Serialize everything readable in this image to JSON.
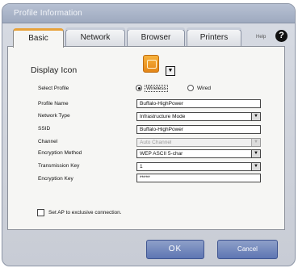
{
  "window": {
    "title": "Profile Information"
  },
  "tabs": [
    {
      "label": "Basic"
    },
    {
      "label": "Network"
    },
    {
      "label": "Browser"
    },
    {
      "label": "Printers"
    }
  ],
  "help": {
    "label": "Help",
    "icon": "?"
  },
  "display_icon": {
    "label": "Display Icon",
    "dropdown_glyph": "▼"
  },
  "select_profile": {
    "label": "Select Profile",
    "options": [
      {
        "label": "Wireless",
        "checked": true
      },
      {
        "label": "Wired",
        "checked": false
      }
    ]
  },
  "fields": {
    "profile_name": {
      "label": "Profile Name",
      "value": "Buffalo-HighPower"
    },
    "network_type": {
      "label": "Network Type",
      "value": "Infrastructure Mode"
    },
    "ssid": {
      "label": "SSID",
      "value": "Buffalo-HighPower"
    },
    "channel": {
      "label": "Channel",
      "value": "Auto Channel"
    },
    "encryption_method": {
      "label": "Encryption Method",
      "value": "WEP ASCII 5-char"
    },
    "transmission_key": {
      "label": "Transmission Key",
      "value": "1"
    },
    "encryption_key": {
      "label": "Encryption Key",
      "value": "*****"
    }
  },
  "select_arrow": "▼",
  "exclusive_ap": {
    "label": "Set AP to exclusive connection.",
    "checked": false
  },
  "buttons": {
    "ok": "OK",
    "cancel": "Cancel"
  },
  "colors": {
    "accent": "#e7a23a",
    "button": "#6f86bd",
    "title_bar": "#a9b4c8"
  }
}
